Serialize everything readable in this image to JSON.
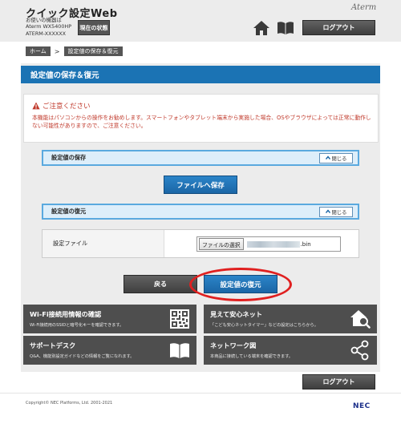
{
  "header": {
    "app_title": "クイック設定Web",
    "device_info_line1": "お使いの機器は",
    "device_info_line2": "Aterm WX5400HP",
    "device_info_line3": "ATERM-XXXXXX",
    "status_button": "現在の状態",
    "brand": "Aterm",
    "home_icon": "home-icon",
    "manual_icon": "book-icon",
    "logout_label": "ログアウト"
  },
  "breadcrumb": {
    "home": "ホーム",
    "separator": ">",
    "current": "設定値の保存＆復元"
  },
  "page": {
    "title": "設定値の保存＆復元",
    "title_bar_color": "#1b73b4"
  },
  "warning": {
    "title": "ご注意ください",
    "text": "本機能はパソコンからの操作をお勧めします。スマートフォンやタブレット端末から実施した場合、OSやブラウザによっては正常に動作しない可能性がありますので、ご注意ください。",
    "color": "#c0392b"
  },
  "save_section": {
    "title": "設定値の保存",
    "close_label": "閉じる",
    "save_button": "ファイルへ保存"
  },
  "restore_section": {
    "title": "設定値の復元",
    "close_label": "閉じる",
    "file_label": "設定ファイル",
    "choose_button": "ファイルの選択",
    "file_extension": ".bin"
  },
  "actions": {
    "back_label": "戻る",
    "restore_label": "設定値の復元",
    "highlight_color": "#e02020"
  },
  "tiles": [
    {
      "title": "Wi-Fi接続用情報の確認",
      "desc": "Wi-Fi接続用のSSIDと暗号化キーを確認できます。",
      "icon": "qr-code-icon"
    },
    {
      "title": "見えて安心ネット",
      "desc": "「こども安心ネットタイマー」などの設定はこちらから。",
      "icon": "home-search-icon"
    },
    {
      "title": "サポートデスク",
      "desc": "Q&A、機能別設定ガイドなどの情報をご覧になれます。",
      "icon": "book-icon"
    },
    {
      "title": "ネットワーク図",
      "desc": "本商品に接続している端末を確認できます。",
      "icon": "network-icon"
    }
  ],
  "footer": {
    "logout_label": "ログアウト",
    "copyright": "Copyright© NEC Platforms, Ltd. 2001-2021",
    "logo": "NEC"
  }
}
